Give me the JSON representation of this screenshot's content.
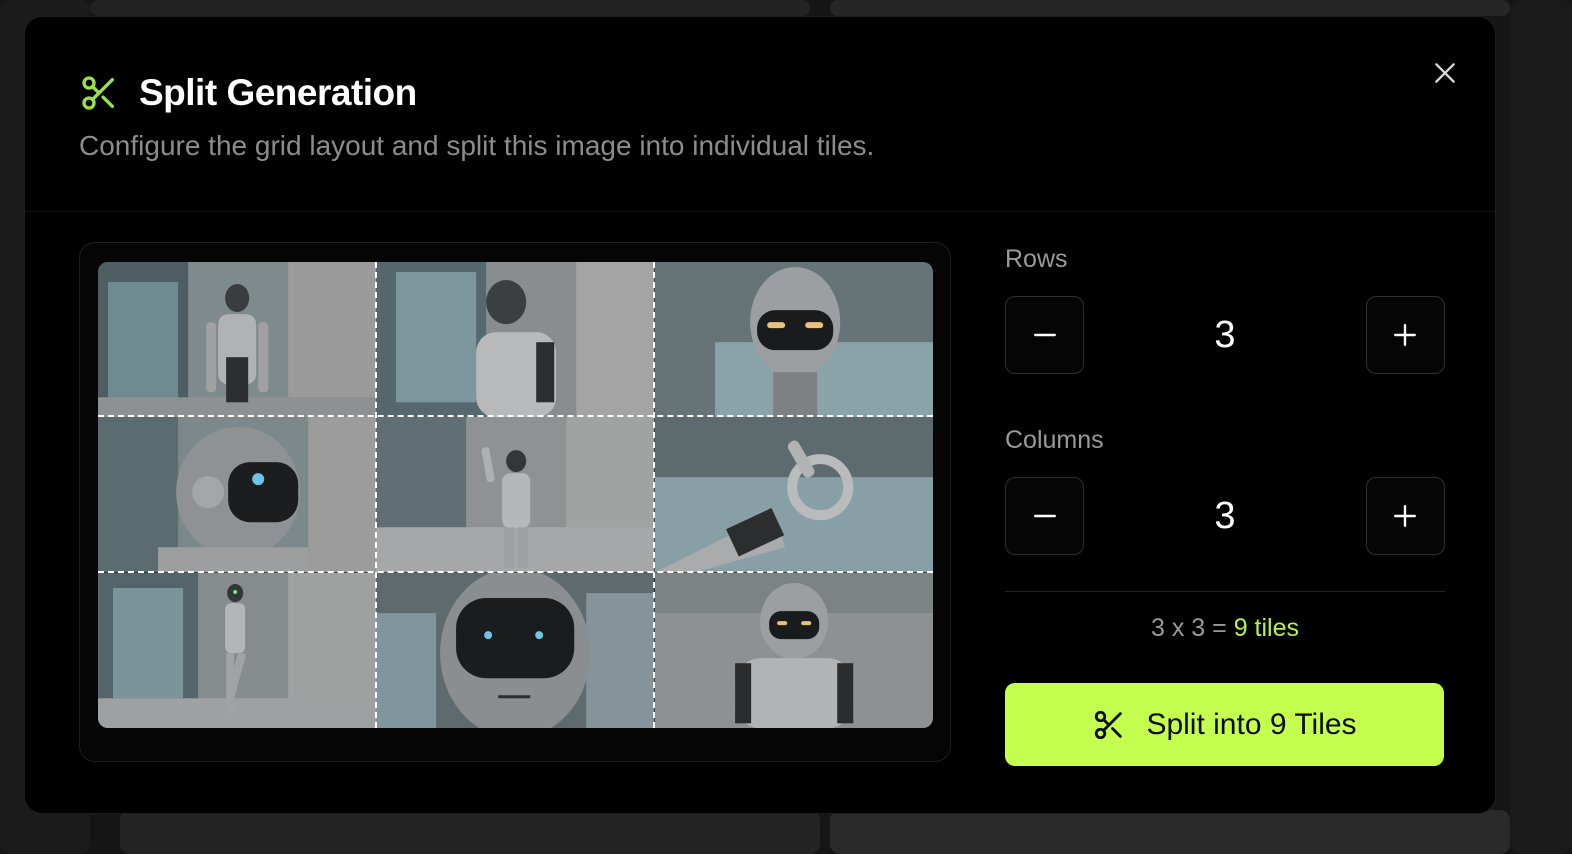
{
  "modal": {
    "title": "Split Generation",
    "subtitle": "Configure the grid layout and split this image into individual tiles.",
    "close_icon": "close-icon",
    "title_icon": "scissors-icon"
  },
  "controls": {
    "rows_label": "Rows",
    "rows_value": "3",
    "columns_label": "Columns",
    "columns_value": "3",
    "summary_prefix": "3 x 3 = ",
    "summary_highlight": "9 tiles",
    "split_button_label": "Split into 9 Tiles",
    "minus_icon": "minus-icon",
    "plus_icon": "plus-icon"
  },
  "colors": {
    "accent": "#c4ff4f",
    "accent_text": "#b6f24a",
    "title_icon": "#9be246"
  },
  "preview": {
    "rows": 3,
    "columns": 3
  }
}
